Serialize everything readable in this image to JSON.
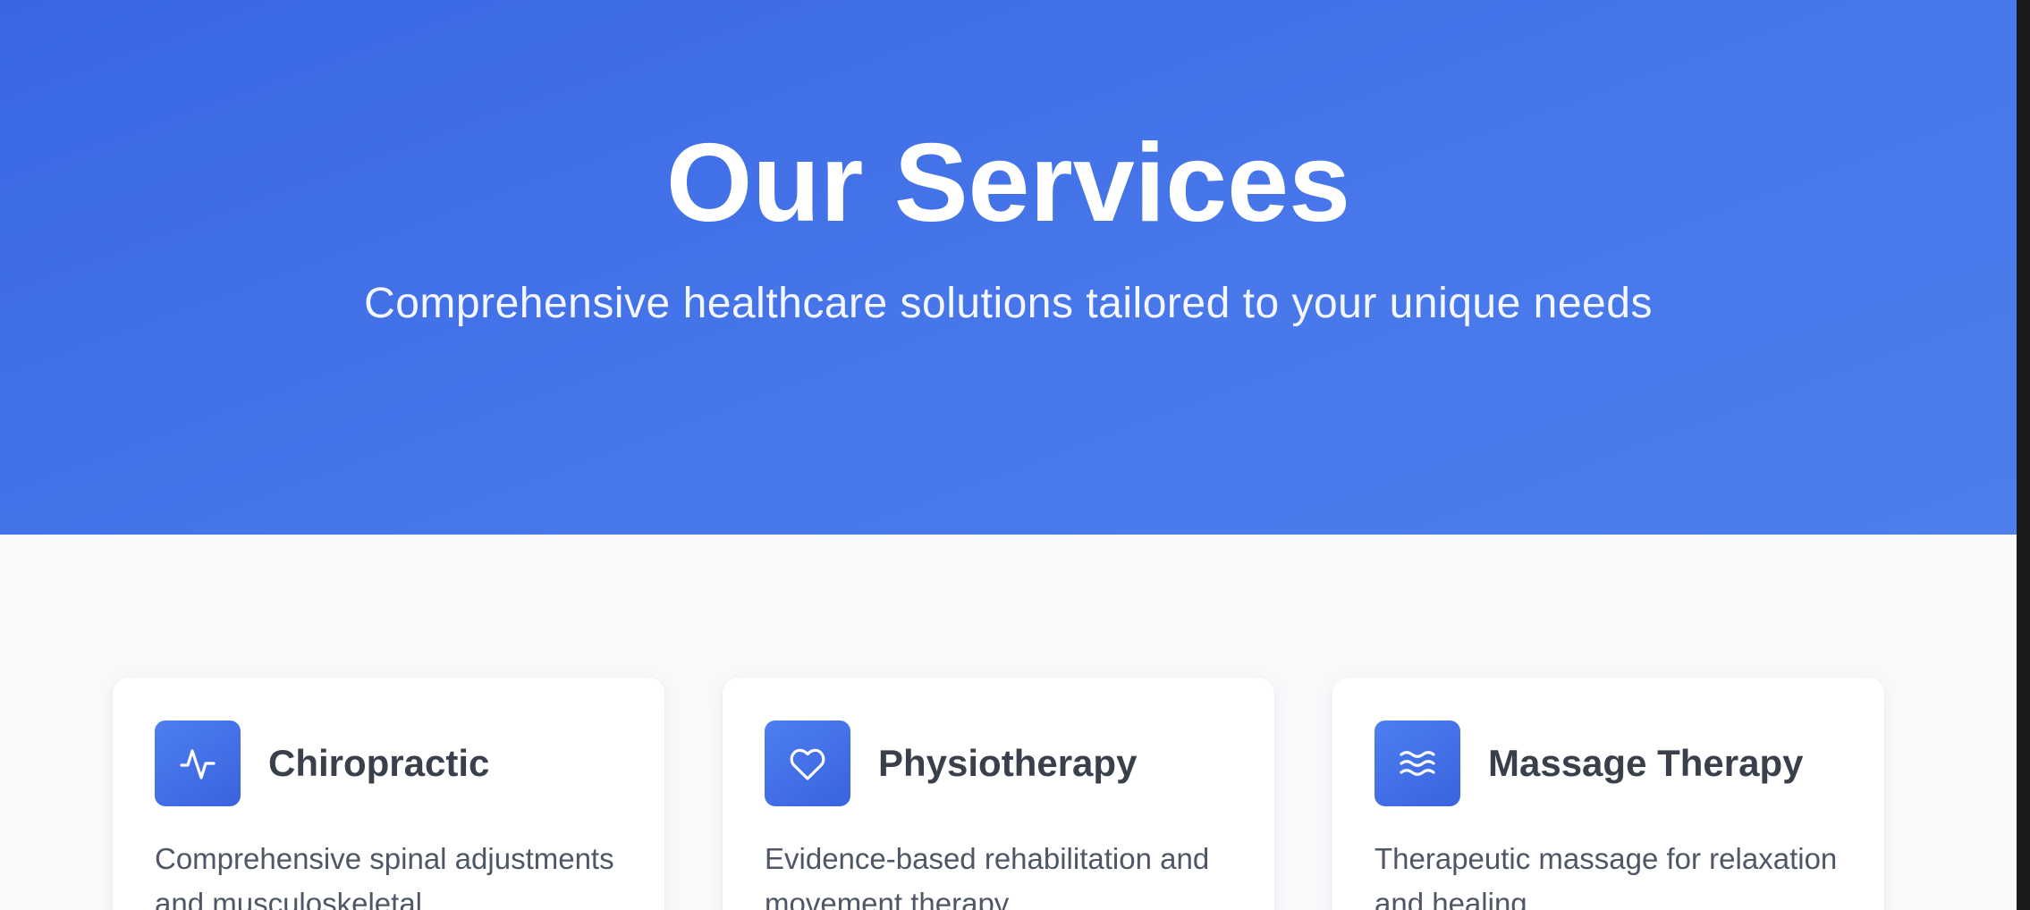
{
  "hero": {
    "title": "Our Services",
    "subtitle": "Comprehensive healthcare solutions tailored to your unique needs"
  },
  "services": [
    {
      "icon": "activity-pulse-icon",
      "title": "Chiropractic",
      "description": "Comprehensive spinal adjustments and musculoskeletal"
    },
    {
      "icon": "heart-icon",
      "title": "Physiotherapy",
      "description": "Evidence-based rehabilitation and movement therapy"
    },
    {
      "icon": "waves-icon",
      "title": "Massage Therapy",
      "description": "Therapeutic massage for relaxation and healing"
    }
  ],
  "colors": {
    "hero_gradient_start": "#3a66e4",
    "hero_gradient_end": "#4d7eec",
    "page_background": "#f8f9fb",
    "card_background": "#ffffff",
    "icon_tile": "#4472ea",
    "title_text": "#3a3f4c",
    "body_text": "#4f5665"
  }
}
